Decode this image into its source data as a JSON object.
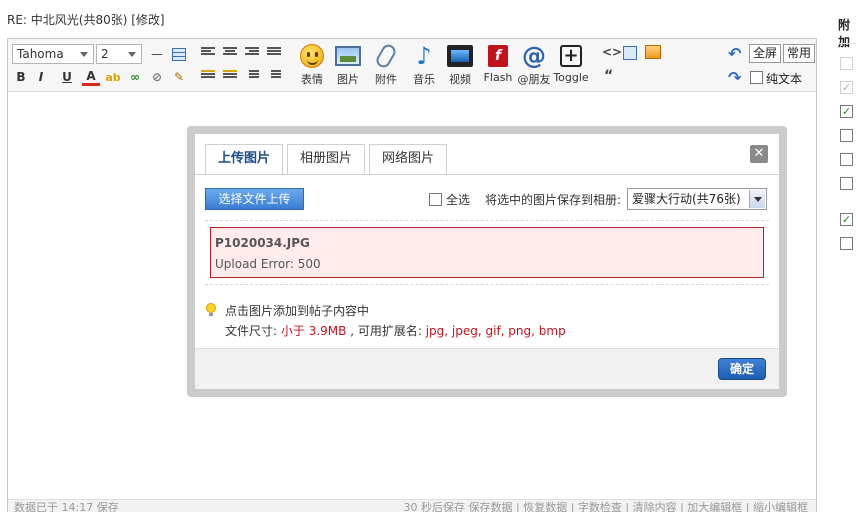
{
  "post": {
    "title": "RE: 中北风光(共80张) [修改]"
  },
  "toolbar": {
    "font": "Tahoma",
    "size": "2",
    "buttons": {
      "bold": "B",
      "italic": "I",
      "underline": "U",
      "color": "A",
      "code": "<>",
      "quote": "“"
    },
    "big": [
      {
        "label": "表情",
        "icon": "smile-icon"
      },
      {
        "label": "图片",
        "icon": "image-icon"
      },
      {
        "label": "附件",
        "icon": "paperclip-icon"
      },
      {
        "label": "音乐",
        "icon": "music-note-icon"
      },
      {
        "label": "视频",
        "icon": "video-icon"
      },
      {
        "label": "Flash",
        "icon": "flash-icon"
      },
      {
        "label": "@朋友",
        "icon": "at-icon"
      },
      {
        "label": "Toggle",
        "icon": "plus-box-icon"
      }
    ],
    "fullscreen": "全屏",
    "common": "常用",
    "plaintext": "纯文本"
  },
  "sidebar": {
    "title": "附加"
  },
  "status": {
    "left": "数据已于 14:17 保存",
    "right": "30 秒后保存 保存数据 | 恢复数据 | 字数检查 | 清除内容 | 加大编辑框 | 缩小编辑框"
  },
  "dialog": {
    "tabs": [
      "上传图片",
      "相册图片",
      "网络图片"
    ],
    "upload_button": "选择文件上传",
    "select_all": "全选",
    "save_to_album_label": "将选中的图片保存到相册:",
    "album_selected": "爱骤大行动(共76张)",
    "error": {
      "filename": "P1020034.JPG",
      "message": "Upload Error: 500"
    },
    "hint_click": "点击图片添加到帖子内容中",
    "hint_size_prefix": "文件尺寸:",
    "hint_size_limit": "小于 3.9MB",
    "hint_ext_prefix": ", 可用扩展名:",
    "hint_ext_list": "jpg, jpeg, gif, png, bmp",
    "ok": "确定"
  },
  "colors": {
    "accent": "#3a7dd3",
    "error_border": "#b72025",
    "error_bg": "#ffebec",
    "red_text": "#c4121d"
  }
}
